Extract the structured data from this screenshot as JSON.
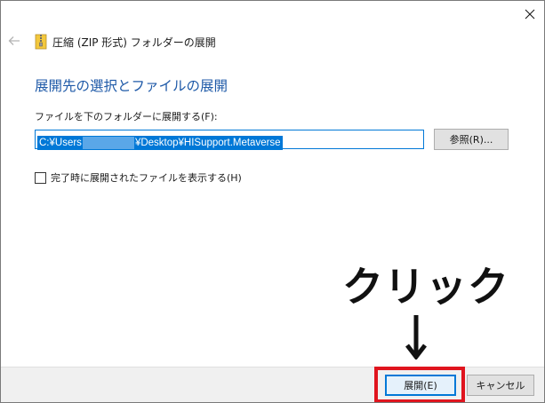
{
  "window": {
    "title": "圧縮 (ZIP 形式) フォルダーの展開"
  },
  "main": {
    "heading": "展開先の選択とファイルの展開",
    "destination_label": "ファイルを下のフォルダーに展開する(F):",
    "destination_path_start": "C:¥Users",
    "destination_path_end": "¥Desktop¥HISupport.Metaverse",
    "browse_label": "参照(R)...",
    "show_files_label": "完了時に展開されたファイルを表示する(H)",
    "show_files_checked": false
  },
  "footer": {
    "extract_label": "展開(E)",
    "cancel_label": "キャンセル"
  },
  "annotation": {
    "text": "クリック"
  },
  "colors": {
    "accent": "#0078d7",
    "heading": "#1f5aa8",
    "highlight": "#e0141e"
  },
  "icons": {
    "close": "close-icon",
    "back": "back-arrow-icon",
    "zip": "zip-folder-icon",
    "annotation_arrow": "arrow-down-icon"
  }
}
